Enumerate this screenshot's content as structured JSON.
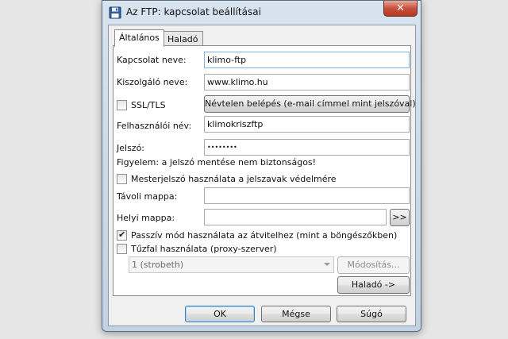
{
  "window": {
    "title": "Az FTP: kapcsolat beállításai",
    "close_symbol": "✕"
  },
  "tabs": [
    {
      "label": "Általános"
    },
    {
      "label": "Haladó"
    }
  ],
  "form": {
    "connection_name_label": "Kapcsolat neve:",
    "connection_name_value": "klimo-ftp",
    "server_name_label": "Kiszolgáló neve:",
    "server_name_value": "www.klimo.hu",
    "ssl_label": "SSL/TLS",
    "ssl_checked": false,
    "anonymous_button": "Névtelen belépés (e-mail címmel mint jelszóval)",
    "username_label": "Felhasználói név:",
    "username_value": "klimokriszftp",
    "password_label": "Jelszó:",
    "password_value": "••••••••",
    "password_warning": "Figyelem: a jelszó mentése nem biztonságos!",
    "master_password_label": "Mesterjelszó használata a jelszavak védelmére",
    "master_password_checked": false,
    "remote_folder_label": "Távoli mappa:",
    "remote_folder_value": "",
    "local_folder_label": "Helyi mappa:",
    "local_folder_value": "",
    "browse_button": ">>",
    "passive_mode_label": "Passzív mód használata az átvitelhez (mint a böngészőkben)",
    "passive_mode_checked": true,
    "firewall_label": "Tűzfal használata (proxy-szerver)",
    "firewall_checked": false,
    "firewall_select_value": "1 (strobeth)",
    "modify_button": "Módosítás...",
    "advanced_button": "Haladó ->"
  },
  "footer": {
    "ok": "OK",
    "cancel": "Mégse",
    "help": "Súgó"
  },
  "colors": {
    "title_gradient_top": "#d7e3ef",
    "close_red": "#c9513c",
    "default_button_border": "#3c7fb1"
  }
}
